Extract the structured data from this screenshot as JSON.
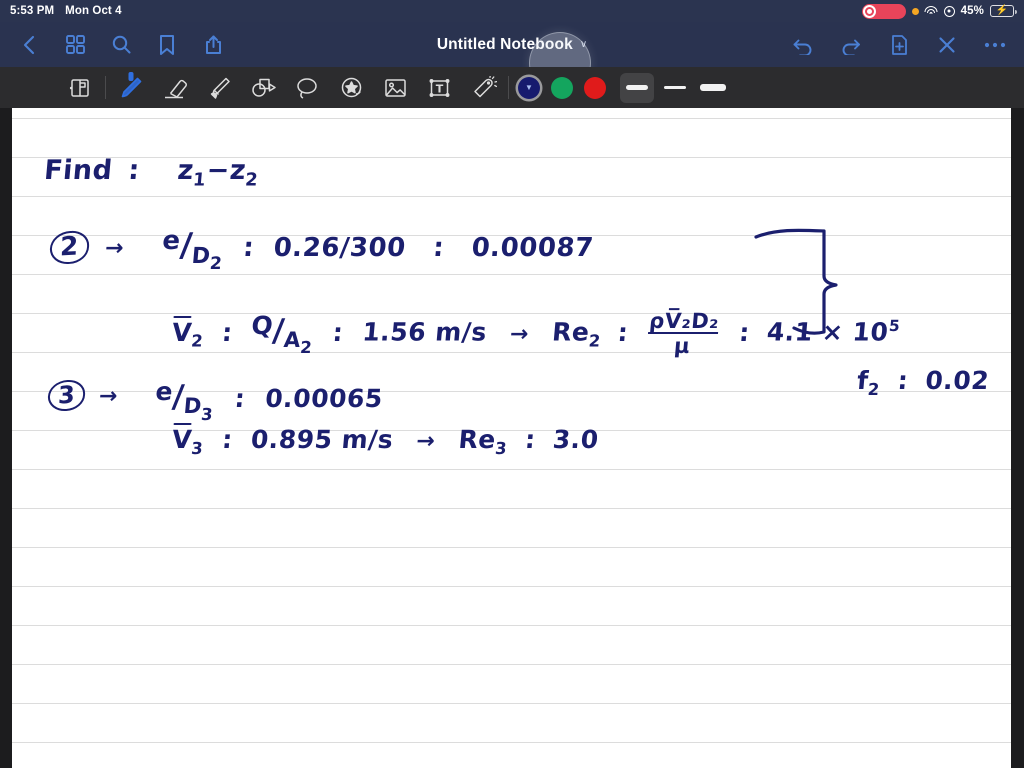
{
  "status_bar": {
    "time": "5:53 PM",
    "date": "Mon Oct 4",
    "battery_percent": "45%",
    "icons": [
      "screen-recording-indicator",
      "orange-mic-dot",
      "wifi-icon",
      "location-icon",
      "battery-charging-icon"
    ],
    "colors": {
      "background": "#2b3450",
      "record_red": "#e8445a",
      "battery_green": "#4cd964"
    }
  },
  "nav_bar": {
    "title": "Untitled Notebook",
    "title_chevron": "∨",
    "left_buttons": [
      {
        "name": "back-button",
        "icon": "chevron-left-icon"
      },
      {
        "name": "thumbnails-button",
        "icon": "grid-icon"
      },
      {
        "name": "search-button",
        "icon": "search-icon"
      },
      {
        "name": "bookmark-button",
        "icon": "bookmark-icon"
      },
      {
        "name": "share-button",
        "icon": "share-icon"
      }
    ],
    "right_buttons": [
      {
        "name": "undo-button",
        "icon": "undo-arrow-icon"
      },
      {
        "name": "redo-button",
        "icon": "redo-arrow-icon"
      },
      {
        "name": "add-page-button",
        "icon": "page-plus-icon"
      },
      {
        "name": "close-button",
        "icon": "x-icon"
      },
      {
        "name": "more-button",
        "icon": "ellipsis-icon"
      }
    ],
    "colors": {
      "background": "#2a3350",
      "icon_blue": "#4a7fd4"
    }
  },
  "toolbar": {
    "tools": [
      {
        "name": "page-tool",
        "icon": "page-flip-icon",
        "selected": false
      },
      {
        "name": "pen-tool",
        "icon": "pen-icon",
        "selected": true
      },
      {
        "name": "eraser-tool",
        "icon": "eraser-icon",
        "selected": false
      },
      {
        "name": "highlighter-tool",
        "icon": "highlighter-icon",
        "selected": false
      },
      {
        "name": "shapes-tool",
        "icon": "shapes-icon",
        "selected": false
      },
      {
        "name": "lasso-tool",
        "icon": "lasso-icon",
        "selected": false
      },
      {
        "name": "sticker-tool",
        "icon": "star-sticker-icon",
        "selected": false
      },
      {
        "name": "image-tool",
        "icon": "image-icon",
        "selected": false
      },
      {
        "name": "text-tool",
        "icon": "text-box-icon",
        "selected": false
      },
      {
        "name": "laser-tool",
        "icon": "magic-wand-icon",
        "selected": false
      }
    ],
    "colors": [
      {
        "name": "color-swatch-navy",
        "hex": "#171b6e",
        "active": true
      },
      {
        "name": "color-swatch-green",
        "hex": "#14a55e",
        "active": false
      },
      {
        "name": "color-swatch-red",
        "hex": "#e01b1b",
        "active": false
      }
    ],
    "widths": [
      {
        "name": "stroke-width-medium",
        "active": true
      },
      {
        "name": "stroke-width-thin",
        "active": false
      },
      {
        "name": "stroke-width-thick",
        "active": false
      }
    ],
    "colors_ui": {
      "background": "#2c2c2e",
      "icon": "#dcdcdc",
      "selected_tool": "#2f6fe0"
    }
  },
  "page": {
    "ink_color": "#1b1f6e",
    "paper_color": "#ffffff",
    "rule_color": "#dcdcdc",
    "rule_spacing_px": 39,
    "notes": {
      "line1": {
        "label": "Find",
        "colon": ":",
        "expr_z1": "z",
        "sub1": "1",
        "minus": "−",
        "expr_z2": "z",
        "sub2": "2"
      },
      "step2": {
        "number": "2",
        "arrow": "→",
        "e_over_d": {
          "numerator": "e",
          "slash": "/",
          "denominator": "D",
          "sub": "2"
        },
        "eq1": ":",
        "value_ratio": "0.26/300",
        "eq2": ":",
        "value_result": "0.00087"
      },
      "step2b": {
        "v_symbol": "V",
        "v_sub": "2",
        "eq1": ":",
        "q_over_a": {
          "numerator": "Q",
          "slash": "/",
          "denominator": "A",
          "sub": "2"
        },
        "eq2": ":",
        "velocity": "1.56 m/s",
        "arrow": "→",
        "re_label": "Re",
        "re_sub": "2",
        "eq3": ":",
        "re_formula_num": "ρV̅₂D₂",
        "re_formula_den": "μ",
        "eq4": ":",
        "re_value": "4.1 × 10",
        "re_exponent": "5"
      },
      "brace_result": {
        "symbol": "f",
        "sub": "2",
        "eq": ":",
        "value": "0.02"
      },
      "step3": {
        "number": "3",
        "arrow": "→",
        "e_over_d": {
          "numerator": "e",
          "slash": "/",
          "denominator": "D",
          "sub": "3"
        },
        "eq": ":",
        "value": "0.00065"
      },
      "step3b": {
        "v_symbol": "V",
        "v_sub": "3",
        "eq1": ":",
        "velocity": "0.895 m/s",
        "arrow": "→",
        "re_label": "Re",
        "re_sub": "3",
        "eq2": ":",
        "re_value": "3.0"
      }
    }
  }
}
